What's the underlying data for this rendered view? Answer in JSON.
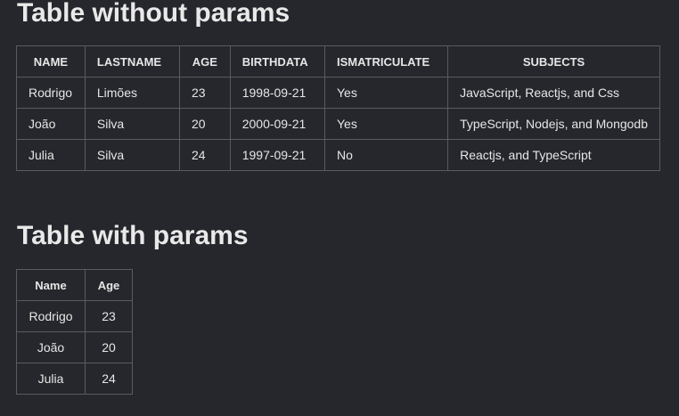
{
  "table1": {
    "title": "Table without params",
    "headers": [
      "NAME",
      "LASTNAME",
      "AGE",
      "BIRTHDATA",
      "ISMATRICULATE",
      "SUBJECTS"
    ],
    "rows": [
      [
        "Rodrigo",
        "Limões",
        "23",
        "1998-09-21",
        "Yes",
        "JavaScript, Reactjs, and Css"
      ],
      [
        "João",
        "Silva",
        "20",
        "2000-09-21",
        "Yes",
        "TypeScript, Nodejs, and Mongodb"
      ],
      [
        "Julia",
        "Silva",
        "24",
        "1997-09-21",
        "No",
        "Reactjs, and TypeScript"
      ]
    ]
  },
  "table2": {
    "title": "Table with params",
    "headers": [
      "Name",
      "Age"
    ],
    "rows": [
      [
        "Rodrigo",
        "23"
      ],
      [
        "João",
        "20"
      ],
      [
        "Julia",
        "24"
      ]
    ]
  }
}
